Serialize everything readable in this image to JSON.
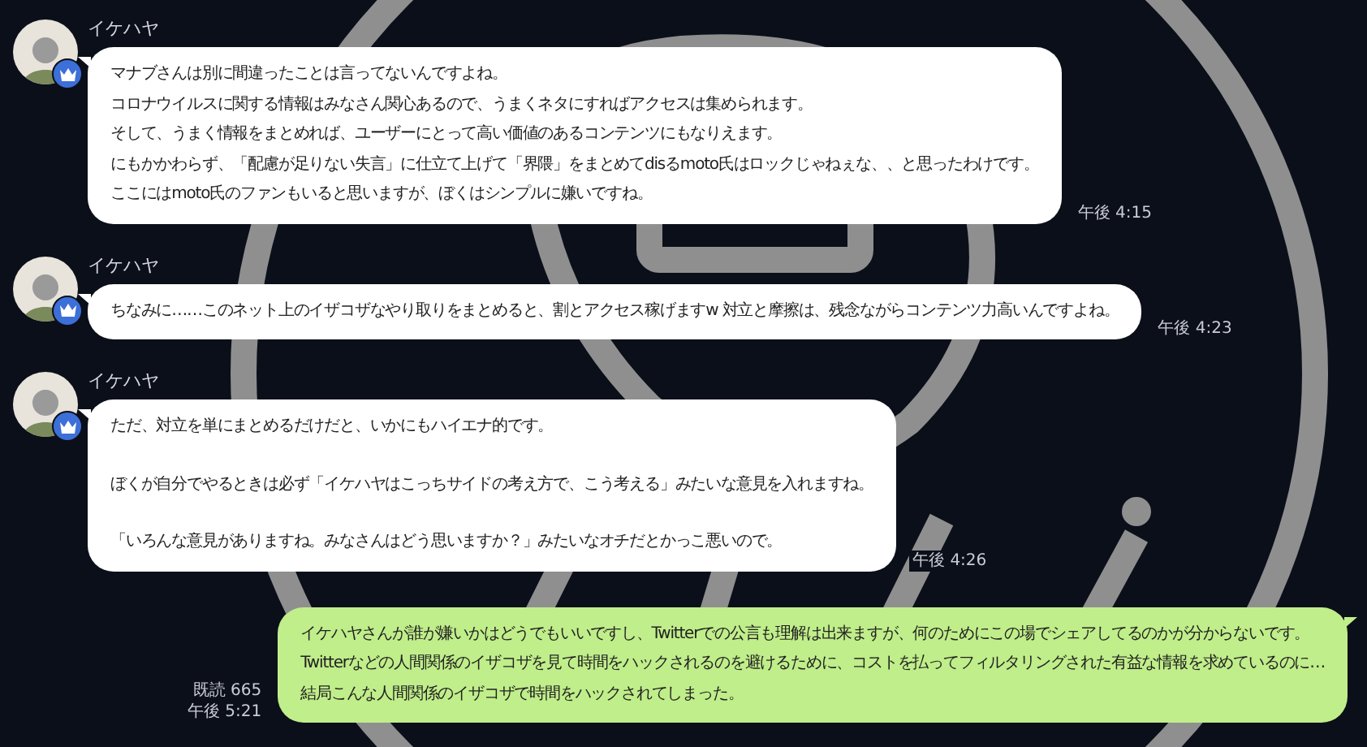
{
  "messages": [
    {
      "kind": "incoming",
      "sender": "イケハヤ",
      "paragraphs": [
        [
          "マナブさんは別に間違ったことは言ってないんですよね。",
          "コロナウイルスに関する情報はみなさん関心あるので、うまくネタにすればアクセスは集められます。",
          "そして、うまく情報をまとめれば、ユーザーにとって高い価値のあるコンテンツにもなりえます。",
          "にもかかわらず、「配慮が足りない失言」に仕立て上げて「界隈」をまとめてdisるmoto氏はロックじゃねぇな、、と思ったわけです。",
          "ここにはmoto氏のファンもいると思いますが、ぼくはシンプルに嫌いですね。"
        ]
      ],
      "time": "午後 4:15"
    },
    {
      "kind": "incoming",
      "sender": "イケハヤ",
      "paragraphs": [
        [
          "ちなみに……このネット上のイザコザなやり取りをまとめると、割とアクセス稼げますw 対立と摩擦は、残念ながらコンテンツ力高いんですよね。"
        ]
      ],
      "time": "午後 4:23"
    },
    {
      "kind": "incoming",
      "sender": "イケハヤ",
      "paragraphs": [
        [
          "ただ、対立を単にまとめるだけだと、いかにもハイエナ的です。"
        ],
        [
          "ぼくが自分でやるときは必ず「イケハヤはこっちサイドの考え方で、こう考える」みたいな意見を入れますね。"
        ],
        [
          "「いろんな意見がありますね。みなさんはどう思いますか？」みたいなオチだとかっこ悪いので。"
        ]
      ],
      "time": "午後 4:26"
    },
    {
      "kind": "outgoing",
      "read": "既読 665",
      "paragraphs": [
        [
          "イケハヤさんが誰が嫌いかはどうでもいいですし、Twitterでの公言も理解は出来ますが、何のためにこの場でシェアしてるのかが分からないです。",
          "Twitterなどの人間関係のイザコザを見て時間をハックされるのを避けるために、コストを払ってフィルタリングされた有益な情報を求めているのに…",
          "結局こんな人間関係のイザコザで時間をハックされてしまった。"
        ]
      ],
      "time": "午後 5:21"
    }
  ]
}
